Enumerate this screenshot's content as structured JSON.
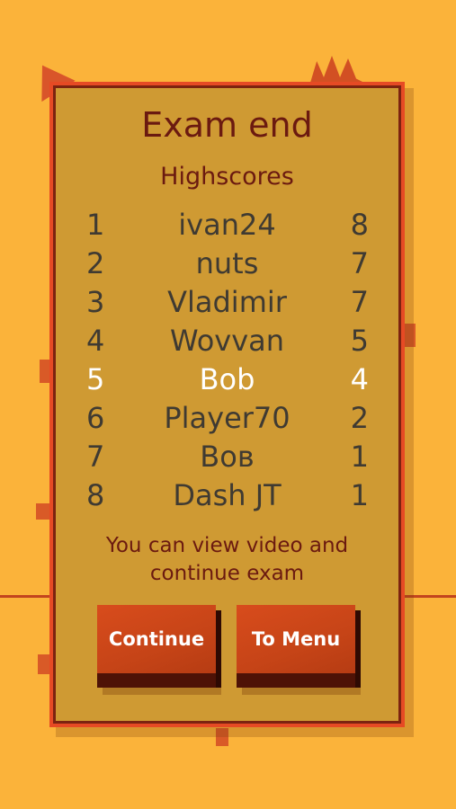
{
  "dialog": {
    "title": "Exam end",
    "subtitle": "Highscores",
    "note_line1": "You can view video and",
    "note_line2": "continue exam"
  },
  "highscores": [
    {
      "rank": "1",
      "name": "ivan24",
      "score": "8"
    },
    {
      "rank": "2",
      "name": "nuts",
      "score": "7"
    },
    {
      "rank": "3",
      "name": "Vladimir",
      "score": "7"
    },
    {
      "rank": "4",
      "name": "Wovvan",
      "score": "5"
    },
    {
      "rank": "5",
      "name": "Bob",
      "score": "4",
      "current_player": true
    },
    {
      "rank": "6",
      "name": "Player70",
      "score": "2"
    },
    {
      "rank": "7",
      "name": "Bов",
      "score": "1"
    },
    {
      "rank": "8",
      "name": "Dash JT",
      "score": "1"
    }
  ],
  "buttons": {
    "continue_label": "Continue",
    "menu_label": "To Menu"
  },
  "colors": {
    "background": "#fbb33a",
    "panel": "#cf9a33",
    "panel_border": "#e64a24",
    "title_text": "#6b1a10",
    "score_text": "#3f3a32",
    "highlight_text": "#ffffff",
    "button": "#c64417"
  }
}
